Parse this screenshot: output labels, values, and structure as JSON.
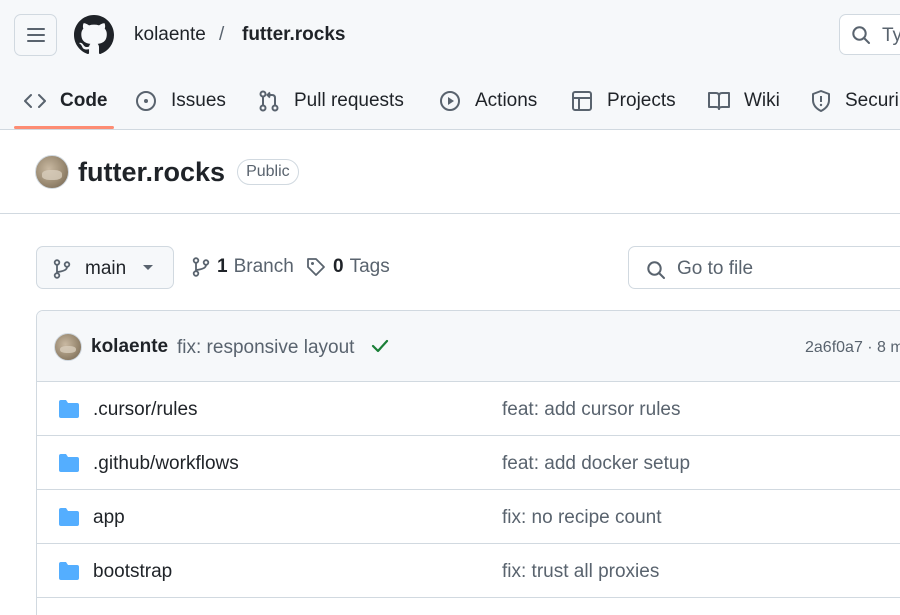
{
  "header": {
    "owner": "kolaente",
    "separator": "/",
    "repo": "futter.rocks",
    "search_placeholder": "Ty"
  },
  "tabs": [
    {
      "label": "Code",
      "icon": "code-icon",
      "active": true
    },
    {
      "label": "Issues",
      "icon": "issue-opened-icon"
    },
    {
      "label": "Pull requests",
      "icon": "git-pull-request-icon"
    },
    {
      "label": "Actions",
      "icon": "play-icon"
    },
    {
      "label": "Projects",
      "icon": "table-icon"
    },
    {
      "label": "Wiki",
      "icon": "book-icon"
    },
    {
      "label": "Securi",
      "icon": "shield-icon"
    }
  ],
  "repo": {
    "name": "futter.rocks",
    "visibility": "Public"
  },
  "branch_bar": {
    "branch": "main",
    "branch_count": "1",
    "branch_label": "Branch",
    "tag_count": "0",
    "tag_label": "Tags",
    "goto_placeholder": "Go to file"
  },
  "latest_commit": {
    "author": "kolaente",
    "message": "fix: responsive layout",
    "hash_time": "2a6f0a7 · 8 m"
  },
  "files": [
    {
      "name": ".cursor/rules",
      "type": "folder",
      "message": "feat: add cursor rules"
    },
    {
      "name": ".github/workflows",
      "type": "folder",
      "message": "feat: add docker setup"
    },
    {
      "name": "app",
      "type": "folder",
      "message": "fix: no recipe count"
    },
    {
      "name": "bootstrap",
      "type": "folder",
      "message": "fix: trust all proxies"
    }
  ],
  "colors": {
    "accent_underline": "#fd8c73",
    "folder": "#54aeff",
    "success": "#1a7f37",
    "border": "#d1d9e0",
    "muted_text": "#59636e"
  }
}
